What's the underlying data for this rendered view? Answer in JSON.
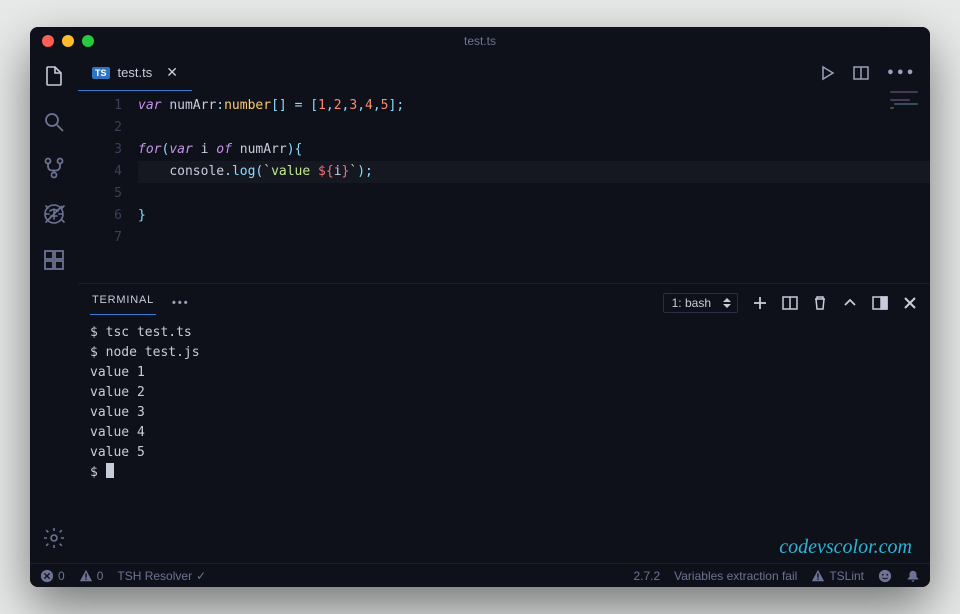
{
  "titlebar": {
    "title": "test.ts"
  },
  "tabs": [
    {
      "icon_label": "TS",
      "filename": "test.ts"
    }
  ],
  "editor": {
    "line_numbers": [
      "1",
      "2",
      "3",
      "4",
      "5",
      "6",
      "7"
    ],
    "code": {
      "l1": {
        "var": "var",
        "name": "numArr",
        "type": "number",
        "eq": "=",
        "nums": [
          "1",
          "2",
          "3",
          "4",
          "5"
        ]
      },
      "l3": {
        "for": "for",
        "var": "var",
        "i": "i",
        "of": "of",
        "arr": "numArr"
      },
      "l4": {
        "console": "console",
        "log": "log",
        "str_pre": "`value ",
        "tmpl_open": "${",
        "tmpl_var": "i",
        "tmpl_close": "}",
        "str_post": "`"
      }
    }
  },
  "panel": {
    "tab_label": "TERMINAL",
    "select_label": "1: bash"
  },
  "terminal": {
    "lines": [
      "$ tsc test.ts",
      "$ node test.js",
      "value 1",
      "value 2",
      "value 3",
      "value 4",
      "value 5"
    ],
    "prompt": "$ "
  },
  "watermark": "codevscolor.com",
  "statusbar": {
    "errors": "0",
    "warnings": "0",
    "resolver": "TSH Resolver",
    "version": "2.7.2",
    "msg": "Variables extraction fail",
    "lint": "TSLint"
  }
}
